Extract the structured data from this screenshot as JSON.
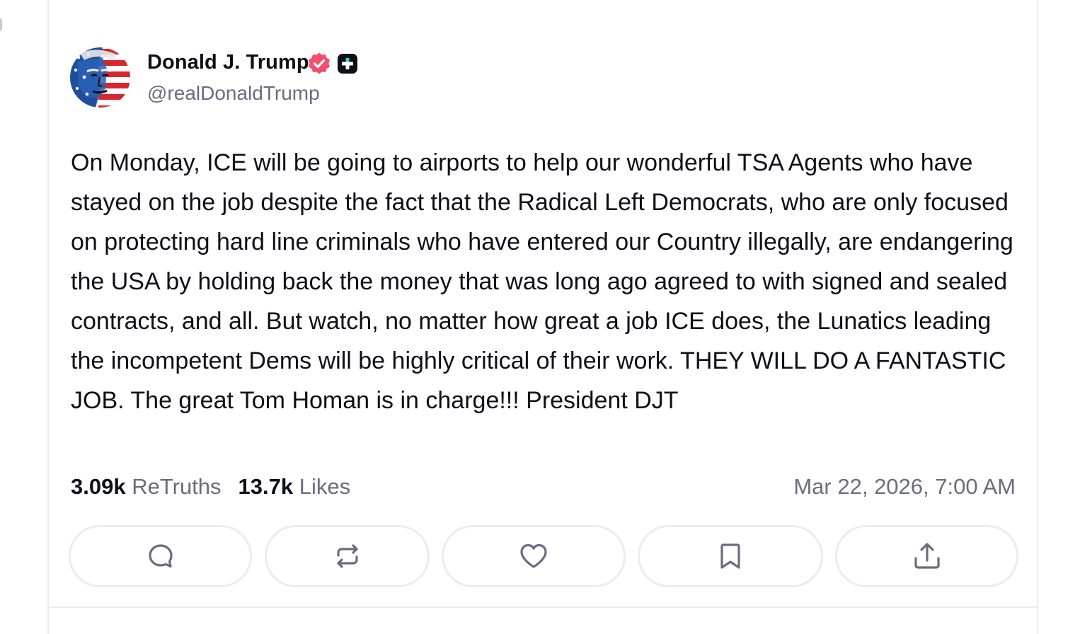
{
  "post": {
    "author_name": "Donald J. Trump",
    "author_handle": "@realDonaldTrump",
    "body": "On Monday, ICE will be going to airports to help our wonderful TSA Agents who have stayed on the job despite the fact that the Radical Left Democrats, who are only focused on protecting hard line criminals who have entered our Country illegally, are endangering the USA by holding back the money that was long ago agreed to with signed and sealed contracts, and all. But watch, no matter how great a job ICE does, the Lunatics leading the incompetent Dems will be highly critical of their work. THEY WILL DO A FANTASTIC JOB. The great Tom Homan is in charge!!! President DJT",
    "retruths_count": "3.09k",
    "retruths_label": "ReTruths",
    "likes_count": "13.7k",
    "likes_label": "Likes",
    "timestamp": "Mar 22, 2026, 7:00 AM"
  },
  "icons": {
    "verified": "verified-badge-icon",
    "plus_badge": "plus-badge-icon",
    "reply": "reply-icon",
    "retruth": "retruth-icon",
    "like": "heart-icon",
    "bookmark": "bookmark-icon",
    "share": "share-icon"
  },
  "colors": {
    "text_primary": "#0f0f1a",
    "text_secondary": "#6b6b80",
    "verified_badge": "#f0506e",
    "border": "#ececf0"
  }
}
